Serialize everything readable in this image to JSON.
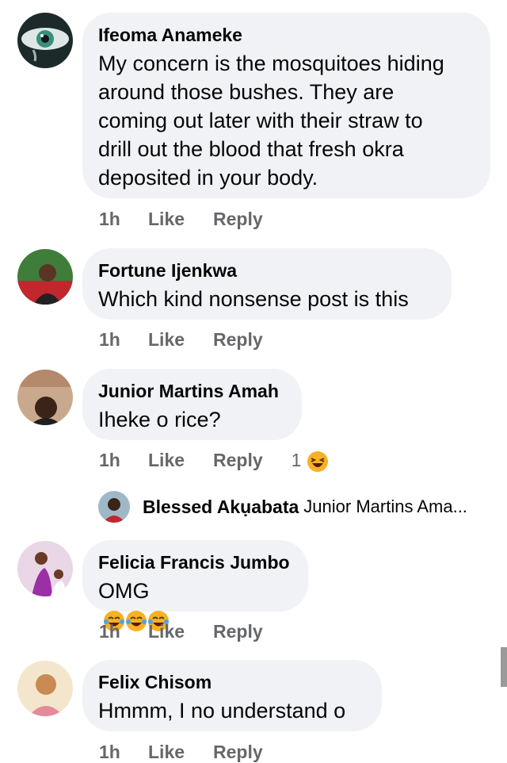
{
  "comments": [
    {
      "author": "Ifeoma Anameke",
      "text": "My concern is the mosquitoes hiding\naround those bushes. They are\ncoming out later with their straw to\ndrill out the blood that fresh okra\ndeposited in your body.",
      "time": "1h",
      "like": "Like",
      "reply": "Reply",
      "avatar_icon": "eye-avatar"
    },
    {
      "author": "Fortune Ijenkwa",
      "text": "Which kind nonsense post is this",
      "time": "1h",
      "like": "Like",
      "reply": "Reply",
      "avatar_icon": "person-avatar"
    },
    {
      "author": "Junior Martins Amah",
      "text": "Iheke o rice?",
      "time": "1h",
      "like": "Like",
      "reply": "Reply",
      "reaction_count": "1",
      "reaction_icon": "laughing-emoji",
      "avatar_icon": "person-avatar"
    },
    {
      "author": "Felicia Francis Jumbo",
      "text": "OMG",
      "emojis": [
        "tears-of-joy-emoji",
        "tears-of-joy-emoji",
        "tears-of-joy-emoji"
      ],
      "time": "1h",
      "like": "Like",
      "reply": "Reply",
      "avatar_icon": "person-avatar"
    },
    {
      "author": "Felix Chisom",
      "text": "Hmmm, I no understand o",
      "time": "1h",
      "like": "Like",
      "reply": "Reply",
      "avatar_icon": "person-avatar"
    }
  ],
  "reply_preview": {
    "author": "Blessed Akụabata",
    "text": "Junior Martins Ama..."
  },
  "colors": {
    "bubble": "#f0f2f5",
    "meta_text": "#65676b",
    "primary_text": "#050505",
    "emoji_yellow": "#f7b125"
  }
}
